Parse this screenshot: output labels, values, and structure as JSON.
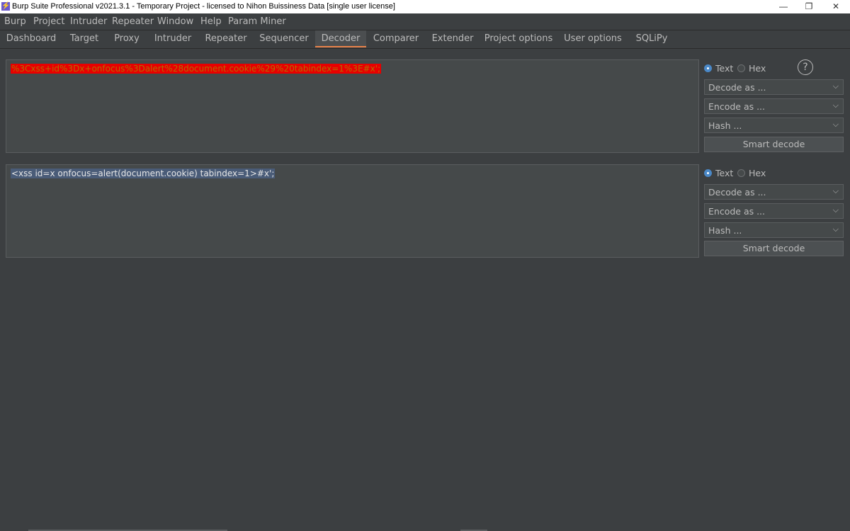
{
  "window": {
    "title": "Burp Suite Professional v2021.3.1 - Temporary Project - licensed to Nihon Buissiness Data [single user license]",
    "app_icon": "burp-lightning-icon"
  },
  "menu": [
    "Burp",
    "Project",
    "Intruder",
    "Repeater",
    "Window",
    "Help",
    "Param Miner"
  ],
  "tabs": [
    {
      "label": "Dashboard"
    },
    {
      "label": "Target"
    },
    {
      "label": "Proxy"
    },
    {
      "label": "Intruder"
    },
    {
      "label": "Repeater"
    },
    {
      "label": "Sequencer"
    },
    {
      "label": "Decoder",
      "active": true
    },
    {
      "label": "Comparer"
    },
    {
      "label": "Extender"
    },
    {
      "label": "Project options"
    },
    {
      "label": "User options"
    },
    {
      "label": "SQLiPy"
    }
  ],
  "panels": [
    {
      "content": "%3Cxss+id%3Dx+onfocus%3Dalert%28document.cookie%29%20tabindex=1%3E#x';",
      "text_label": "Text",
      "hex_label": "Hex",
      "decode_label": "Decode as ...",
      "encode_label": "Encode as ...",
      "hash_label": "Hash ...",
      "smart_label": "Smart decode"
    },
    {
      "content": "<xss id=x onfocus=alert(document.cookie) tabindex=1>#x';",
      "text_label": "Text",
      "hex_label": "Hex",
      "decode_label": "Decode as ...",
      "encode_label": "Encode as ...",
      "hash_label": "Hash ...",
      "smart_label": "Smart decode"
    }
  ],
  "help_glyph": "?",
  "colors": {
    "background": "#3c3f41",
    "editor": "#45494a",
    "active_tab_underline": "#e8824a",
    "selection_red": "#e80000",
    "selection_blue": "#4a5c78",
    "radio_checked": "#4a88c7"
  }
}
